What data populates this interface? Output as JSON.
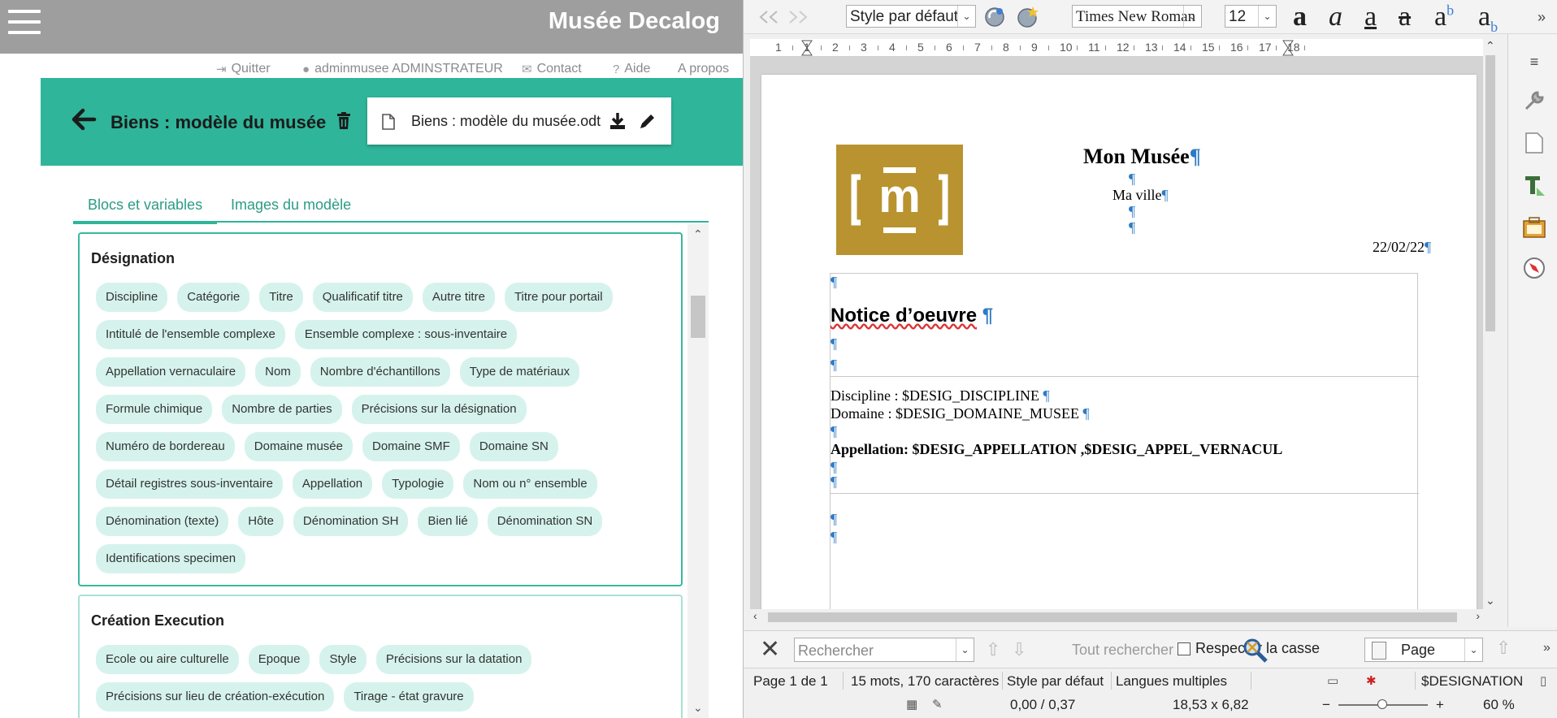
{
  "web": {
    "app_title": "Musée Decalog",
    "topnav": {
      "quit": "Quitter",
      "user": "adminmusee ADMINSTRATEUR",
      "contact": "Contact",
      "help": "Aide",
      "about": "A propos"
    },
    "banner": {
      "title": "Biens : modèle du musée",
      "file_name": "Biens : modèle du musée.odt"
    },
    "tabs": {
      "blocs": "Blocs et variables",
      "images": "Images du modèle"
    },
    "blocks": {
      "designation": {
        "title": "Désignation",
        "chips": [
          "Discipline",
          "Catégorie",
          "Titre",
          "Qualificatif titre",
          "Autre titre",
          "Titre pour portail",
          "Intitulé de l'ensemble complexe",
          "Ensemble complexe : sous-inventaire",
          "Appellation vernaculaire",
          "Nom",
          "Nombre d'échantillons",
          "Type de matériaux",
          "Formule chimique",
          "Nombre de parties",
          "Précisions sur la désignation",
          "Numéro de bordereau",
          "Domaine musée",
          "Domaine SMF",
          "Domaine SN",
          "Détail registres sous-inventaire",
          "Appellation",
          "Typologie",
          "Nom ou n° ensemble",
          "Dénomination (texte)",
          "Hôte",
          "Dénomination SH",
          "Bien lié",
          "Dénomination SN",
          "Identifications specimen"
        ]
      },
      "creation": {
        "title": "Création Execution",
        "chips": [
          "Ecole ou aire culturelle",
          "Epoque",
          "Style",
          "Précisions sur la datation",
          "Précisions sur lieu de création-exécution",
          "Tirage - état gravure"
        ]
      }
    }
  },
  "writer": {
    "toolbar": {
      "paragraph_style": "Style par défaut",
      "font_name": "Times New Roman",
      "font_size": "12"
    },
    "ruler_labels": [
      "1",
      "1",
      "2",
      "3",
      "4",
      "5",
      "6",
      "7",
      "8",
      "9",
      "10",
      "11",
      "12",
      "13",
      "14",
      "15",
      "16",
      "17",
      "18"
    ],
    "doc": {
      "title": "Mon Musée",
      "city": "Ma ville",
      "date": "22/02/22",
      "notice": "Notice d’oeuvre",
      "discipline_line": "Discipline : $DESIG_DISCIPLINE",
      "domaine_line": "Domaine : $DESIG_DOMAINE_MUSEE",
      "appellation_line": "Appellation: $DESIG_APPELLATION ,$DESIG_APPEL_VERNACUL",
      "logo_letter": "m",
      "pilcrow": "¶"
    },
    "find": {
      "placeholder": "Rechercher",
      "find_all": "Tout rechercher",
      "match_case": "Respecter la casse",
      "scope": "Page"
    },
    "status": {
      "page": "Page 1 de 1",
      "words": "15 mots, 170 caractères",
      "style": "Style par défaut",
      "language": "Langues multiples",
      "field": "$DESIGNATION",
      "position": "0,00 / 0,37",
      "size": "18,53 x 6,82",
      "zoom": "60 %"
    }
  }
}
